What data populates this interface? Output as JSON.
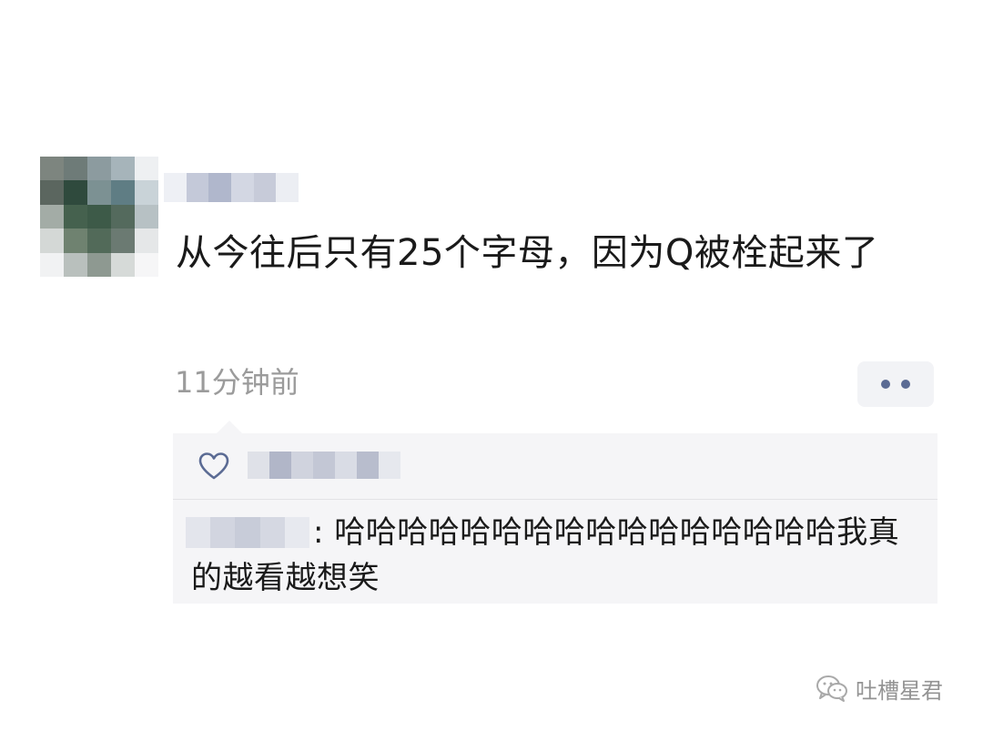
{
  "post": {
    "text": "从今往后只有25个字母，因为Q被栓起来了",
    "time": "11分钟前"
  },
  "comment": {
    "separator": ":",
    "text": "哈哈哈哈哈哈哈哈哈哈哈哈哈哈哈哈我真的越看越想笑"
  },
  "icons": {
    "like": "heart-outline-icon",
    "more": "more-dots-icon",
    "watermark": "wechat-icon"
  },
  "watermark": {
    "label": "吐槽星君"
  },
  "colors": {
    "link_blue": "#5b6b94",
    "timestamp_gray": "#9b9b9b",
    "comment_bg": "#f5f5f7"
  }
}
